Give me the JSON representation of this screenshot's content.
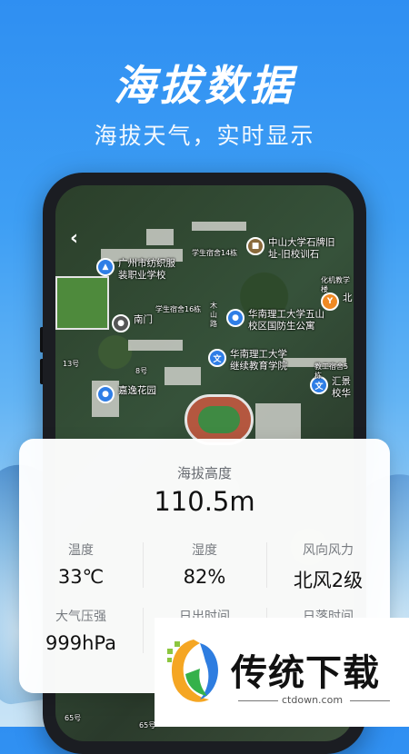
{
  "header": {
    "title": "海拔数据",
    "subtitle": "海拔天气，实时显示"
  },
  "map": {
    "back_icon": "chevron-left-icon",
    "pois": [
      {
        "icon": "graduation-cap-icon",
        "text": "广州市纺织服\n装职业学校",
        "color": "#2f7ee6"
      },
      {
        "icon": "building-icon",
        "text": "中山大学石牌旧\n址-旧校训石",
        "color": "#8a6a3c"
      },
      {
        "icon": "location-icon",
        "text": "南门",
        "color": "#555555"
      },
      {
        "icon": "location-icon",
        "text": "华南理工大学五山\n校区国防生公寓",
        "color": "#2f7ee6"
      },
      {
        "icon": "school-icon",
        "text": "华南理工大学\n继续教育学院",
        "color": "#2f7ee6"
      },
      {
        "icon": "location-icon",
        "text": "嘉逸花园",
        "color": "#2f7ee6"
      },
      {
        "icon": "fork-icon",
        "text": "北",
        "color": "#f08a24"
      },
      {
        "icon": "school-icon",
        "text": "汇景\n校华",
        "color": "#2f7ee6"
      }
    ],
    "labels": [
      "学生宿舍14栋",
      "学生宿舍16栋",
      "木\n山\n路",
      "化机教学楼",
      "教工宿舍5栋",
      "13号",
      "8号",
      "65号",
      "65号"
    ]
  },
  "card": {
    "altitude_label": "海拔高度",
    "altitude_value": "110.5m",
    "grid": [
      {
        "label": "温度",
        "value": "33℃"
      },
      {
        "label": "湿度",
        "value": "82%"
      },
      {
        "label": "风向风力",
        "value": "北风2级"
      },
      {
        "label": "大气压强",
        "value": "999hPa"
      },
      {
        "label": "日出时间",
        "value": ""
      },
      {
        "label": "日落时间",
        "value": ""
      }
    ]
  },
  "watermark": {
    "text": "传统下载",
    "url": "ctdown.com"
  },
  "colors": {
    "background_top": "#2f8ff2",
    "card": "#ffffff",
    "primary_text": "#111111",
    "secondary_text": "#777b80"
  }
}
